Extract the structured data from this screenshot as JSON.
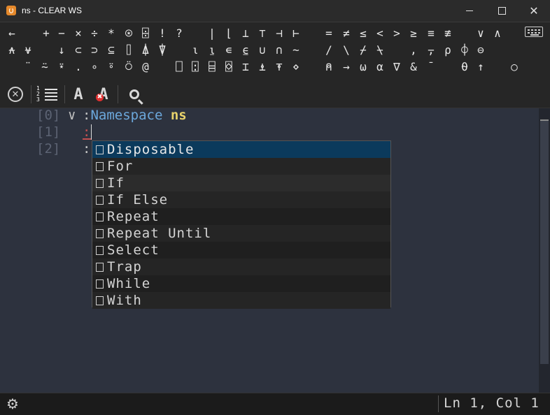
{
  "window": {
    "title": "ns - CLEAR WS",
    "minimize_icon": "minimize-icon",
    "maximize_icon": "maximize-icon",
    "close_glyph": "✕"
  },
  "language_bar": {
    "row1": [
      "←",
      "+",
      "−",
      "×",
      "÷",
      "*",
      "⍟",
      "⌹",
      "!",
      "?",
      "|",
      "⌊",
      "⊥",
      "⊤",
      "⊣",
      "⊢",
      "=",
      "≠",
      "≤",
      "<",
      ">",
      "≥",
      "≡",
      "≢",
      "∨",
      "∧"
    ],
    "row2": [
      "⍲",
      "⍱",
      "↓",
      "⊂",
      "⊃",
      "⊆",
      "⌷",
      "⍋",
      "⍒",
      "⍳",
      "⍸",
      "∊",
      "⍷",
      "∪",
      "∩",
      "~",
      "/",
      "\\",
      "⌿",
      "⍀",
      ",",
      "⍪",
      "⍴",
      "⌽",
      "⊖"
    ],
    "row3": [
      "¨",
      "⍨",
      "⍣",
      ".",
      "∘",
      "⍤",
      "⍥",
      "@",
      "⎕",
      "⍠",
      "⌸",
      "⌺",
      "⌶",
      "⍎",
      "⍕",
      "⋄",
      "⍝",
      "→",
      "⍵",
      "⍺",
      "∇",
      "&",
      "¯",
      "⍬",
      "↑",
      "○"
    ],
    "keyboard_icon": "keyboard-icon"
  },
  "toolbar": {
    "close_glyph": "✕",
    "line_numbers_digits": "1\n2\n3",
    "autocomplete_glyph": "A",
    "autocomplete_off_glyph": "A",
    "autocomplete_off_badge": "✖"
  },
  "editor": {
    "lines": [
      {
        "num": "[0]",
        "fold": "∨",
        "colon": ":",
        "keyword": "Namespace",
        "name": "ns"
      },
      {
        "num": "[1]",
        "colon": ":"
      },
      {
        "num": "[2]",
        "colon": ":"
      }
    ]
  },
  "autocomplete": {
    "items": [
      "Disposable",
      "For",
      "If",
      "If Else",
      "Repeat",
      "Repeat Until",
      "Select",
      "Trap",
      "While",
      "With"
    ],
    "selected_index": 0,
    "hover_index": 2
  },
  "status": {
    "position": "Ln 1, Col 1",
    "settings_glyph": "⚙"
  }
}
